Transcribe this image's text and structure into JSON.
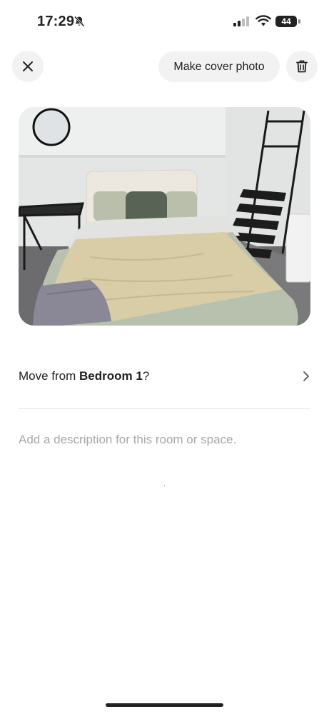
{
  "status_bar": {
    "time": "17:29",
    "battery": "44",
    "bell_icon": "bell-slash-icon",
    "signal_icon": "cellular-signal-icon",
    "wifi_icon": "wifi-icon"
  },
  "toolbar": {
    "close_icon": "close-icon",
    "cover_label": "Make cover photo",
    "trash_icon": "trash-icon"
  },
  "photo": {
    "subject": "bedroom-photo"
  },
  "move": {
    "prefix": "Move from ",
    "room": "Bedroom 1",
    "suffix": "?",
    "chevron_icon": "chevron-right-icon"
  },
  "description": {
    "placeholder": "Add a description for this room or space."
  },
  "colors": {
    "button_bg": "#f2f2f2",
    "text": "#222222",
    "placeholder": "#a8a8a8",
    "divider": "#e6e6e6"
  }
}
